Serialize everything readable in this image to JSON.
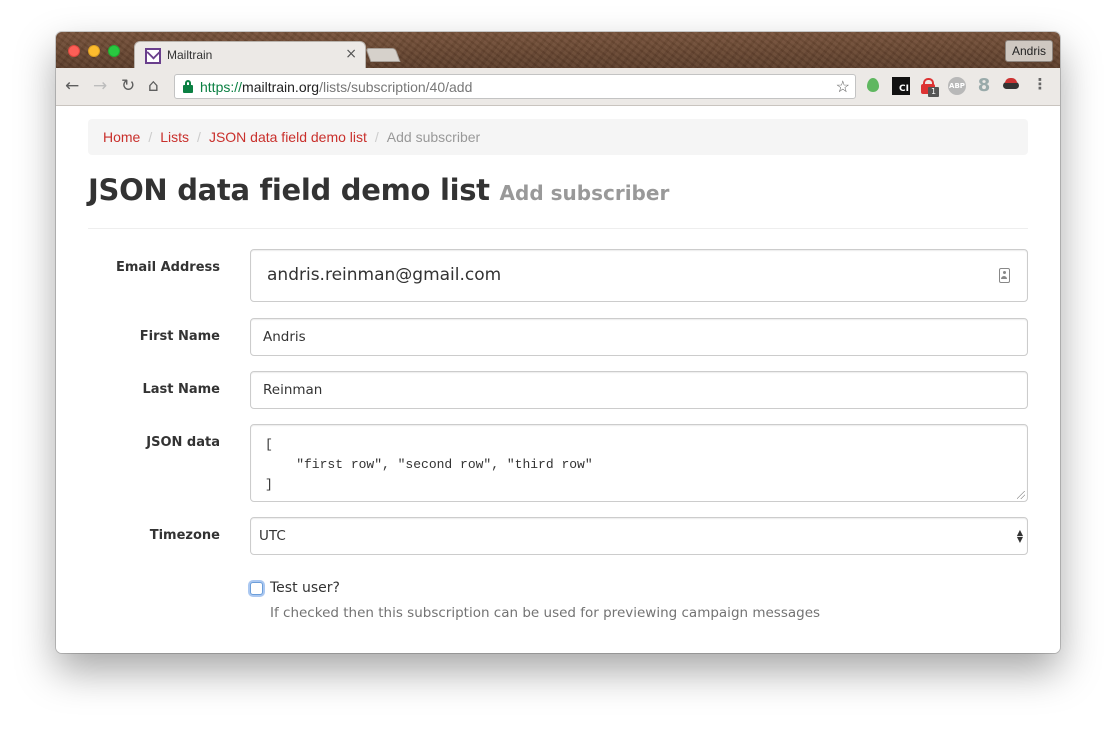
{
  "browser": {
    "tab_title": "Mailtrain",
    "tab_close": "×",
    "profile_name": "Andris",
    "url_scheme": "https://",
    "url_host": "mailtrain.org",
    "url_path": "/lists/subscription/40/add",
    "extensions": [
      "evernote-icon",
      "ci-icon",
      "lock-icon",
      "abp-icon",
      "google-icon",
      "mask-icon"
    ],
    "ext_ci_label": "CI",
    "ext_lock_badge": "1",
    "ext_abp_label": "ABP",
    "ext_g_label": "8"
  },
  "breadcrumb": {
    "items": [
      "Home",
      "Lists",
      "JSON data field demo list"
    ],
    "active": "Add subscriber",
    "separator": "/"
  },
  "page": {
    "title": "JSON data field demo list",
    "subtitle": "Add subscriber"
  },
  "form": {
    "email": {
      "label": "Email Address",
      "value": "andris.reinman@gmail.com"
    },
    "first_name": {
      "label": "First Name",
      "value": "Andris"
    },
    "last_name": {
      "label": "Last Name",
      "value": "Reinman"
    },
    "json_data": {
      "label": "JSON data",
      "value": "[\n    \"first row\", \"second row\", \"third row\"\n]"
    },
    "timezone": {
      "label": "Timezone",
      "value": "UTC"
    },
    "test_user": {
      "label": "Test user?",
      "checked": false,
      "help": "If checked then this subscription can be used for previewing campaign messages"
    }
  },
  "colors": {
    "link": "#c9302c",
    "secure": "#0b8043",
    "muted": "#999999"
  }
}
